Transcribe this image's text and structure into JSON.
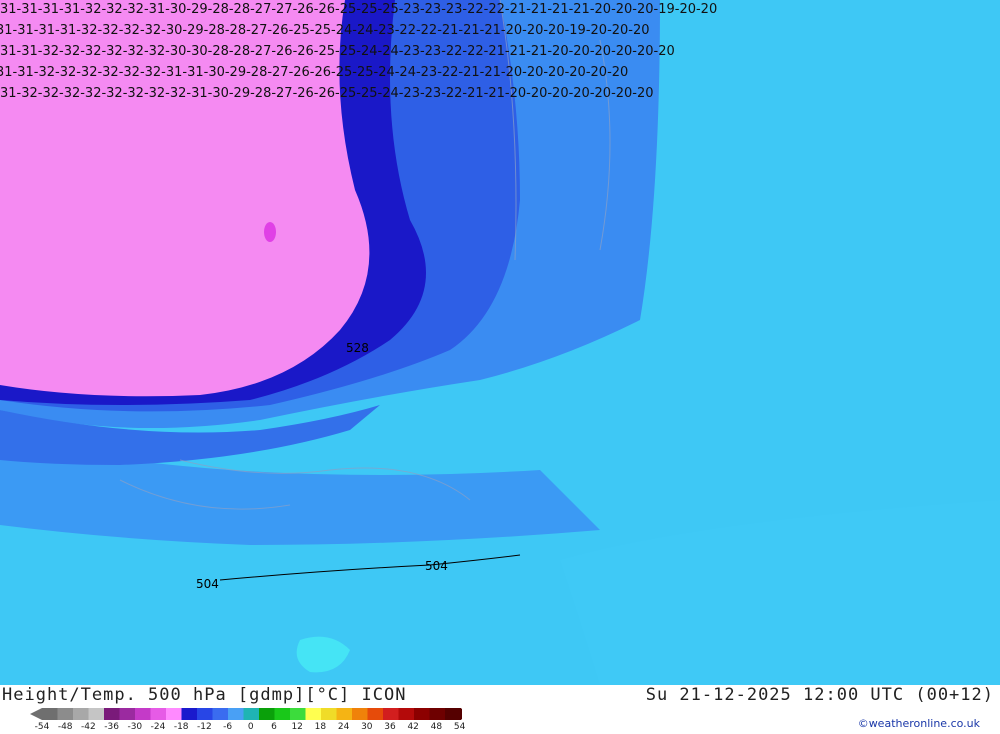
{
  "map": {
    "numbers_top_rows": [
      "31 31 31 31 32 32 32 31 30 29 28 28 27 27 26 26 25 25 25 23 23 23 22 22 21 21 21 21 20 20 20 19 20 20",
      "31 31 31 31 32 32 32 32 30 29 28 28 27 26 25 25 24 24 23 22 22 21 21 21 20 20 20 19 20 20 20",
      "31 31 32 32 32 32 32 32 30 30 28 28 27 26 26 25 25 24 24 23 23 22 22 21 21 21 20 20 20 20 20 20",
      "31 31 32 32 32 32 32 32 31 31 30 29 28 27 26 26 25 25 24 24 23 22 21 21 20 20 20 20 20 20",
      "31 32 32 32 32 32 32 32 32 31 30 29 28 27 26 26 25 25 24 23 23 22 21 21 20 20 20 20 20 20 20"
    ],
    "label_504_a": "504",
    "label_504_b": "504",
    "label_528": "528"
  },
  "legend": {
    "title": "Height/Temp. 500 hPa [gdmp][°C] ICON",
    "datetime": "Su 21-12-2025 12:00 UTC (00+12)",
    "credit": "©weatheronline.co.uk",
    "scale_ticks": [
      "-54",
      "-48",
      "-42",
      "-36",
      "-30",
      "-24",
      "-18",
      "-12",
      "-6",
      "0",
      "6",
      "12",
      "18",
      "24",
      "30",
      "36",
      "42",
      "48",
      "54"
    ],
    "scale_colors": [
      "#6f6f6f",
      "#8c8c8c",
      "#a8a8a8",
      "#c5c5c5",
      "#7a1a7a",
      "#9b2aa0",
      "#c43ac8",
      "#e65be6",
      "#ff8aff",
      "#1a1acd",
      "#2846e6",
      "#3a6cf0",
      "#49a0f5",
      "#1fb4b4",
      "#0aa00a",
      "#19c819",
      "#3cdc3c",
      "#ffff50",
      "#f0dc28",
      "#f5b414",
      "#f0820a",
      "#e64b0a",
      "#d21e1e",
      "#b40a0a",
      "#8c0000",
      "#6e0000",
      "#550000"
    ]
  }
}
